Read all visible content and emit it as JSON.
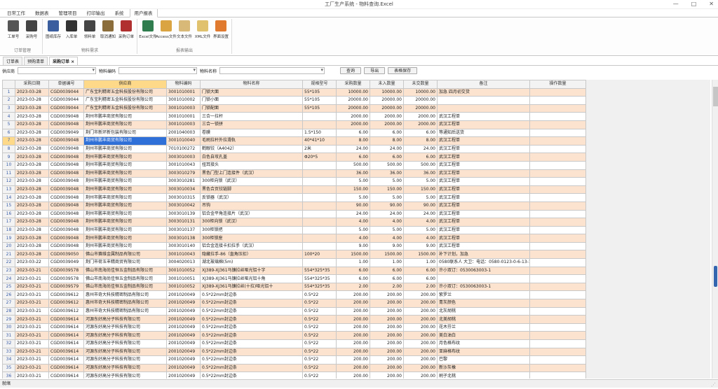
{
  "window": {
    "title": "工厂生产系统 - 物料查询.Excel",
    "min": "—",
    "max": "□",
    "close": "✕"
  },
  "menu": [
    "日常工作",
    "数据表",
    "管理项目",
    "打印输出",
    "系统",
    "用户报表"
  ],
  "ribbon": {
    "groups": [
      {
        "label": "订单管理",
        "buttons": [
          {
            "label": "工单号",
            "color": "#555555"
          },
          {
            "label": "采购号",
            "color": "#444444"
          }
        ]
      },
      {
        "label": "物料需求",
        "buttons": [
          {
            "label": "图纸库存",
            "color": "#3b5f9e"
          },
          {
            "label": "入库单",
            "color": "#333333"
          },
          {
            "label": "领料单",
            "color": "#444444"
          },
          {
            "label": "取消通知",
            "color": "#8a6d3b"
          },
          {
            "label": "采购订单",
            "color": "#b03030"
          }
        ]
      },
      {
        "label": "报表输出",
        "buttons": [
          {
            "label": "Excel文件",
            "color": "#2f7d4e"
          },
          {
            "label": "Access文件",
            "color": "#d9a441"
          },
          {
            "label": "文本文件",
            "color": "#d9b978"
          },
          {
            "label": "XML文件",
            "color": "#e0c16e"
          },
          {
            "label": "界面设置",
            "color": "#e07a2f"
          }
        ]
      }
    ]
  },
  "doc_tabs": [
    "订单表",
    "预购清单",
    "采购订单 ×"
  ],
  "filter": {
    "supplier_label": "供应商",
    "material_code_label": "物料编码",
    "material_name_label": "物料名称",
    "query_button": "查询",
    "print_button": "导出",
    "save_button": "表格保存"
  },
  "grid": {
    "columns": [
      "采购日期",
      "单据编号",
      "供应商",
      "物料编码",
      "物料名称",
      "规格型号",
      "采购数量",
      "未入数量",
      "未交数量",
      "备注",
      "操作数量"
    ],
    "rows": [
      [
        "2023-03-28",
        "CGD0039044",
        "广东宝利精密五金科技股份有限公司",
        "3001010001",
        "门锁大面",
        "55*105",
        "10000.00",
        "10000.00",
        "10000.00",
        "加急 四月初交货"
      ],
      [
        "2023-03-28",
        "CGD0039044",
        "广东宝利精密五金科技股份有限公司",
        "3001010002",
        "门锁小面",
        "55*105",
        "20000.00",
        "20000.00",
        "20000.00",
        ""
      ],
      [
        "2023-03-28",
        "CGD0039044",
        "广东宝利精密五金科技股份有限公司",
        "3001010003",
        "门锁配面",
        "55*105",
        "20000.00",
        "20000.00",
        "20000.00",
        ""
      ],
      [
        "2023-03-28",
        "CGD0039048",
        "荆州市鹏丰商贸有限公司",
        "3001010001",
        "三合一拉杆",
        "",
        "2000.00",
        "2000.00",
        "2000.00",
        "武汉工程单"
      ],
      [
        "2023-03-28",
        "CGD0039048",
        "荆州市鹏丰商贸有限公司",
        "3001010003",
        "三合一锁拼",
        "",
        "2000.00",
        "2000.00",
        "2000.00",
        "武汉工程单"
      ],
      [
        "2023-03-28",
        "CGD0039049",
        "荆门市新环新包装有限公司",
        "2001040003",
        "卷膜",
        "1.5*150",
        "6.00",
        "6.00",
        "6.00",
        "等通知后送货"
      ],
      [
        "2023-03-28",
        "CGD0039048",
        "荆州市鹏丰商贸有限公司",
        "3001010040",
        "毛刷拉杆外拉滑轨",
        "40*41*10",
        "8.00",
        "8.00",
        "8.00",
        "武汉工程单"
      ],
      [
        "2023-03-28",
        "CGD0039048",
        "荆州市鹏丰商贸有限公司",
        "7010100272",
        "鹤眼铰（A4042）",
        "2米",
        "24.00",
        "24.00",
        "24.00",
        "武汉工程单"
      ],
      [
        "2023-03-28",
        "CGD0039048",
        "荆州市鹏丰商贸有限公司",
        "3003010003",
        "白色自攻孔盖",
        "Φ20*5",
        "6.00",
        "6.00",
        "6.00",
        "武汉工程单"
      ],
      [
        "2023-03-28",
        "CGD0039048",
        "荆州市鹏丰商贸有限公司",
        "3001010043",
        "扭耳接头",
        "",
        "500.00",
        "500.00",
        "500.00",
        "武汉工程单"
      ],
      [
        "2023-03-28",
        "CGD0039048",
        "荆州市鹏丰商贸有限公司",
        "3003010279",
        "黑色门型上门连接件（武汉）",
        "",
        "36.00",
        "36.00",
        "36.00",
        "武汉工程单"
      ],
      [
        "2023-03-28",
        "CGD0039048",
        "荆州市鹏丰商贸有限公司",
        "3003010281",
        "300柜向锁（武汉）",
        "",
        "5.00",
        "5.00",
        "5.00",
        "武汉工程单"
      ],
      [
        "2023-03-28",
        "CGD0039048",
        "荆州市鹏丰商贸有限公司",
        "3003010034",
        "黑色合页铰链脚",
        "",
        "150.00",
        "150.00",
        "150.00",
        "武汉工程单"
      ],
      [
        "2023-03-28",
        "CGD0039048",
        "荆州市鹏丰商贸有限公司",
        "3003010315",
        "反锁器（武汉）",
        "",
        "5.00",
        "5.00",
        "5.00",
        "武汉工程单"
      ],
      [
        "2023-03-28",
        "CGD0039048",
        "荆州市鹏丰商贸有限公司",
        "3003010042",
        "吊钩",
        "",
        "90.00",
        "90.00",
        "90.00",
        "武汉工程单"
      ],
      [
        "2023-03-28",
        "CGD0039048",
        "荆州市鹏丰商贸有限公司",
        "3003010139",
        "铝合金平角连接片（武汉）",
        "",
        "24.00",
        "24.00",
        "24.00",
        "武汉工程单"
      ],
      [
        "2023-03-28",
        "CGD0039048",
        "荆州市鹏丰商贸有限公司",
        "3003010131",
        "300柜向锁（武汉）",
        "",
        "4.00",
        "4.00",
        "4.00",
        "武汉工程单"
      ],
      [
        "2023-03-28",
        "CGD0039048",
        "荆州市鹏丰商贸有限公司",
        "3003010137",
        "300柜锁把",
        "",
        "5.00",
        "5.00",
        "5.00",
        "武汉工程单"
      ],
      [
        "2023-03-28",
        "CGD0039048",
        "荆州市鹏丰商贸有限公司",
        "3003010138",
        "300柜锁座",
        "",
        "4.00",
        "4.00",
        "4.00",
        "武汉工程单"
      ],
      [
        "2023-03-28",
        "CGD0039048",
        "荆州市鹏丰商贸有限公司",
        "3003010140",
        "铝合金连接卡扣拉手（武汉）",
        "",
        "9.00",
        "9.00",
        "9.00",
        "武汉工程单"
      ],
      [
        "2023-03-28",
        "CGD0039050",
        "佛山市赛维金属制品有限公司",
        "3001010043",
        "隐藏拉手-86（直角压扣）",
        "100*20",
        "1500.00",
        "1500.00",
        "1500.00",
        "补下计划，加急"
      ],
      [
        "2023-03-22",
        "CGD0039049",
        "荆门市荷玉丰精商贸有限公司",
        "3004020013",
        "湖北玻璃棉(5m)",
        "",
        "1.00",
        "1.00",
        "1.00",
        "0580联系人 大卫：电话：0580-0123-0-6-13-12"
      ],
      [
        "2023-03-21",
        "CGD0039578",
        "佛山市南海尚佳恒五金制品有限公司",
        "3001010052",
        "XJ389-XJ361马镰拉丝哑光铝十字",
        "554*325*35",
        "6.00",
        "6.00",
        "6.00",
        "许小双订：0530063003-1"
      ],
      [
        "2023-03-21",
        "CGD0039578",
        "佛山市南海尚佳恒五金制品有限公司",
        "3001010051",
        "XJ389-XJ361马镰拉丝哑光铝十角",
        "554*325*35",
        "6.00",
        "6.00",
        "6.00",
        ""
      ],
      [
        "2023-03-21",
        "CGD0039579",
        "佛山市南海尚佳恒五金制品有限公司",
        "3001010052",
        "XJ389-XJ361马镰拉丝(十拉)哑光铝十",
        "554*325*35",
        "2.00",
        "2.00",
        "2.00",
        "许小双订：0530063003-1"
      ],
      [
        "2023-03-21",
        "CGD0039612",
        "惠州市奇大科技精密制品有限公司",
        "2001020049",
        "0.5*22mm封边条",
        "0.5*22",
        "200.00",
        "200.00",
        "200.00",
        "紫罗兰"
      ],
      [
        "2023-03-21",
        "CGD0039612",
        "惠州市奇大科技精密制品有限公司",
        "2001020049",
        "0.5*22mm封边条",
        "0.5*22",
        "200.00",
        "200.00",
        "200.00",
        "青灰颜色"
      ],
      [
        "2023-03-21",
        "CGD0039612",
        "惠州市奇大科技精密制品有限公司",
        "2001020049",
        "0.5*22mm封边条",
        "0.5*22",
        "200.00",
        "200.00",
        "200.00",
        "北灰胡桃"
      ],
      [
        "2023-03-21",
        "CGD0039614",
        "河源东好高分子科技有限公司",
        "2001020049",
        "0.5*22mm封边条",
        "0.5*22",
        "200.00",
        "200.00",
        "200.00",
        "北美胡桃"
      ],
      [
        "2023-03-21",
        "CGD0039614",
        "河源东好高分子科技有限公司",
        "2001020049",
        "0.5*22mm封边条",
        "0.5*22",
        "200.00",
        "200.00",
        "200.00",
        "花木芬兰"
      ],
      [
        "2023-03-21",
        "CGD0039614",
        "河源东好高分子科技有限公司",
        "2001020049",
        "0.5*22mm封边条",
        "0.5*22",
        "200.00",
        "200.00",
        "200.00",
        "美白油白"
      ],
      [
        "2023-03-21",
        "CGD0039614",
        "河源东好高分子科技有限公司",
        "2001020049",
        "0.5*22mm封边条",
        "0.5*22",
        "200.00",
        "200.00",
        "200.00",
        "月色格布纹"
      ],
      [
        "2023-03-21",
        "CGD0039614",
        "河源东好高分子科技有限公司",
        "2001020049",
        "0.5*22mm封边条",
        "0.5*22",
        "200.00",
        "200.00",
        "200.00",
        "亚麻格布纹"
      ],
      [
        "2023-03-21",
        "CGD0039614",
        "河源东好高分子科技有限公司",
        "2001020049",
        "0.5*22mm封边条",
        "0.5*22",
        "200.00",
        "200.00",
        "200.00",
        "巴黎"
      ],
      [
        "2023-03-21",
        "CGD0039614",
        "河源东好高分子科技有限公司",
        "2001020049",
        "0.5*22mm封边条",
        "0.5*22",
        "200.00",
        "200.00",
        "200.00",
        "新沙灰橡"
      ],
      [
        "2023-03-21",
        "CGD0039614",
        "河源东好高分子科技有限公司",
        "2001020049",
        "0.5*22mm封边条",
        "0.5*22",
        "200.00",
        "200.00",
        "200.00",
        "刷子北桃"
      ]
    ],
    "current_row": 7
  },
  "status": {
    "text": "就绪"
  }
}
